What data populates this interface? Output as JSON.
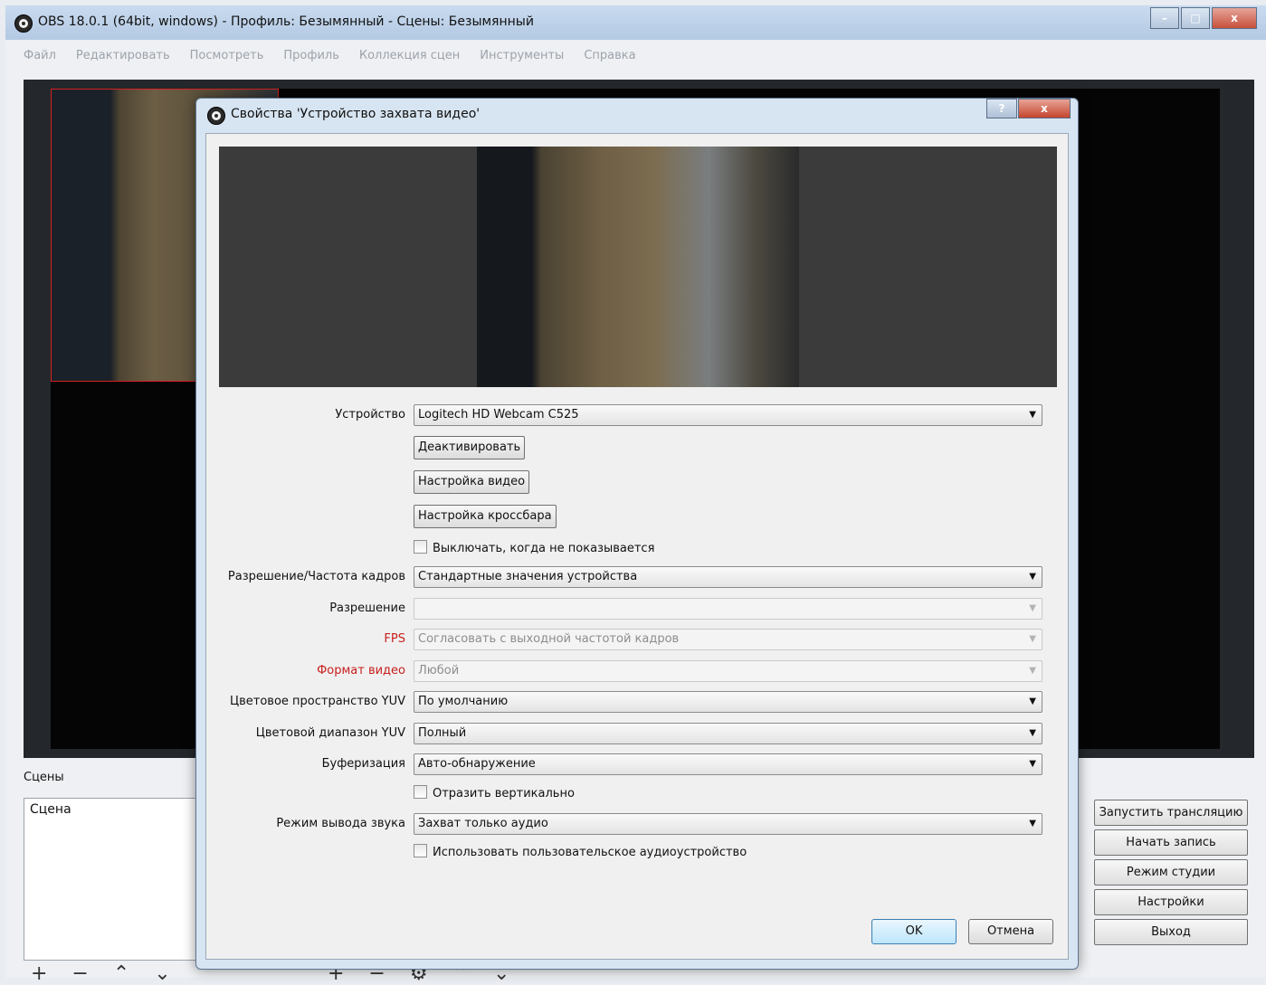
{
  "main": {
    "title": "OBS 18.0.1 (64bit, windows) - Профиль: Безымянный - Сцены: Безымянный",
    "window_controls": {
      "minimize": "–",
      "maximize": "□",
      "close": "x"
    },
    "menu": [
      "Файл",
      "Редактировать",
      "Посмотреть",
      "Профиль",
      "Коллекция сцен",
      "Инструменты",
      "Справка"
    ],
    "scenes_label": "Сцены",
    "scenes": [
      "Сцена"
    ],
    "scene_toolbar": "+ − ⌃ ⌄",
    "source_toolbar": "+ − ⚙ ⌃ ⌄",
    "side_buttons": [
      "Запустить трансляцию",
      "Начать запись",
      "Режим студии",
      "Настройки",
      "Выход"
    ]
  },
  "dialog": {
    "title": "Свойства 'Устройство захвата видео'",
    "help_label": "?",
    "close_label": "x",
    "device_label": "Устройство",
    "device_value": "Logitech HD Webcam C525",
    "deactivate_label": "Деактивировать",
    "video_settings_label": "Настройка видео",
    "crossbar_settings_label": "Настройка кроссбара",
    "deactivate_hidden_label": "Выключать, когда не показывается",
    "resolution_fps_type_label": "Разрешение/Частота кадров",
    "resolution_fps_type_value": "Стандартные значения устройства",
    "resolution_label": "Разрешение",
    "resolution_value": "",
    "fps_label": "FPS",
    "fps_value": "Согласовать с выходной частотой кадров",
    "video_format_label": "Формат видео",
    "video_format_value": "Любой",
    "yuv_space_label": "Цветовое пространство YUV",
    "yuv_space_value": "По умолчанию",
    "yuv_range_label": "Цветовой диапазон YUV",
    "yuv_range_value": "Полный",
    "buffering_label": "Буферизация",
    "buffering_value": "Авто-обнаружение",
    "flip_vertical_label": "Отразить вертикально",
    "audio_mode_label": "Режим вывода звука",
    "audio_mode_value": "Захват только аудио",
    "custom_audio_label": "Использовать пользовательское аудиоустройство",
    "ok_label": "OK",
    "cancel_label": "Отмена"
  },
  "icons": {
    "dropdown_arrow": "▼",
    "app_icon": "obs-logo-icon"
  },
  "colors": {
    "required_label": "#c81e1e",
    "selection_box": "#d61f1f",
    "ok_button": "#bee6fd"
  }
}
